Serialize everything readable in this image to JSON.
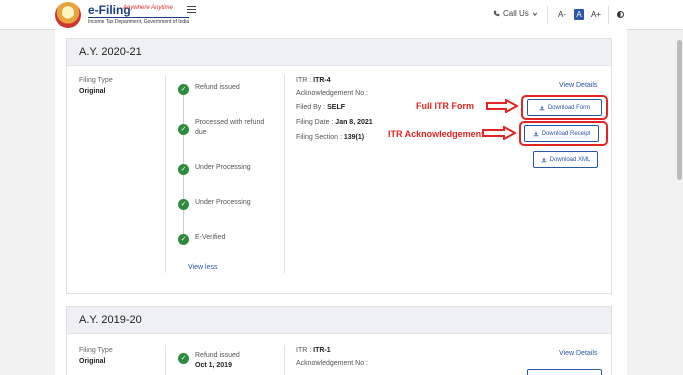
{
  "header": {
    "logo_title": "e-Filing",
    "logo_tagline": "Anywhere Anytime",
    "logo_subtitle": "Income Tax Department, Government of India",
    "call_us": "Call Us",
    "font_small": "A-",
    "font_normal": "A",
    "font_large": "A+"
  },
  "cards": [
    {
      "ay": "A.Y. 2020-21",
      "filing_type_label": "Filing Type",
      "filing_type_value": "Original",
      "steps": [
        {
          "label": "Refund issued",
          "date": ""
        },
        {
          "label": "Processed with refund due",
          "date": ""
        },
        {
          "label": "Under Processing",
          "date": ""
        },
        {
          "label": "Under Processing",
          "date": ""
        },
        {
          "label": "E-Verified",
          "date": ""
        }
      ],
      "view_less": "View less",
      "itr_label": "ITR : ",
      "itr_value": "ITR-4",
      "ack_label": "Acknowledgement No :",
      "filed_by_label": "Filed By : ",
      "filed_by_value": "SELF",
      "filing_date_label": "Filing Date : ",
      "filing_date_value": "Jan 8, 2021",
      "filing_section_label": "Filing Section : ",
      "filing_section_value": "139(1)",
      "view_details": "View Details",
      "download_form": "Download Form",
      "download_receipt": "Download Receipt",
      "download_xml": "Download XML"
    },
    {
      "ay": "A.Y. 2019-20",
      "filing_type_label": "Filing Type",
      "filing_type_value": "Original",
      "steps": [
        {
          "label": "Refund issued",
          "date": "Oct 1, 2019"
        }
      ],
      "itr_label": "ITR : ",
      "itr_value": "ITR-1",
      "ack_label": "Acknowledgement No :",
      "view_details": "View Details"
    }
  ],
  "annotations": {
    "full_itr": "Full ITR Form",
    "itr_ack": "ITR Acknowledgement",
    "color": "#e32424"
  },
  "colors": {
    "accent": "#2a58a6",
    "success": "#2e8b3e",
    "card_header_bg": "#eef0f5"
  },
  "icons": [
    "emblem-logo",
    "menu-icon",
    "phone-icon",
    "chevron-down-icon",
    "contrast-icon",
    "check-icon",
    "download-icon"
  ]
}
